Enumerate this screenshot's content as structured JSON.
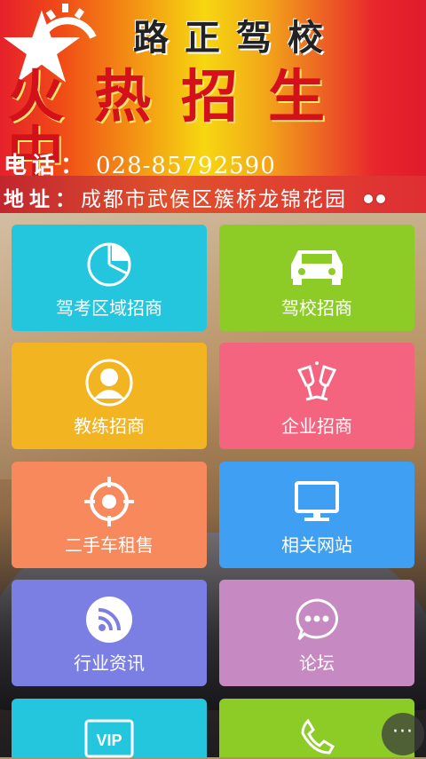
{
  "banner": {
    "school_name": "路正驾校",
    "slogan": "火热招生中",
    "phone_label": "电话：",
    "phone_number": "028-85792590",
    "address_label": "地址：",
    "address_text": "成都市武侯区簇桥龙锦花园"
  },
  "tiles": [
    {
      "label": "驾考区域招商",
      "icon": "pie-chart-icon",
      "color": "#23c6dc"
    },
    {
      "label": "驾校招商",
      "icon": "car-icon",
      "color": "#8dcc26"
    },
    {
      "label": "教练招商",
      "icon": "person-icon",
      "color": "#f2b421"
    },
    {
      "label": "企业招商",
      "icon": "wine-glasses-icon",
      "color": "#f4647f"
    },
    {
      "label": "二手车租售",
      "icon": "target-icon",
      "color": "#f7895c"
    },
    {
      "label": "相关网站",
      "icon": "monitor-icon",
      "color": "#3f9ff2"
    },
    {
      "label": "行业资讯",
      "icon": "rss-icon",
      "color": "#7b7fe4"
    },
    {
      "label": "论坛",
      "icon": "chat-bubble-icon",
      "color": "#c789c2"
    },
    {
      "label": "",
      "icon": "vip-icon",
      "color": "#23c6dc"
    },
    {
      "label": "",
      "icon": "phone-icon",
      "color": "#8dcc26"
    }
  ],
  "floating_button": {
    "label": "···"
  }
}
